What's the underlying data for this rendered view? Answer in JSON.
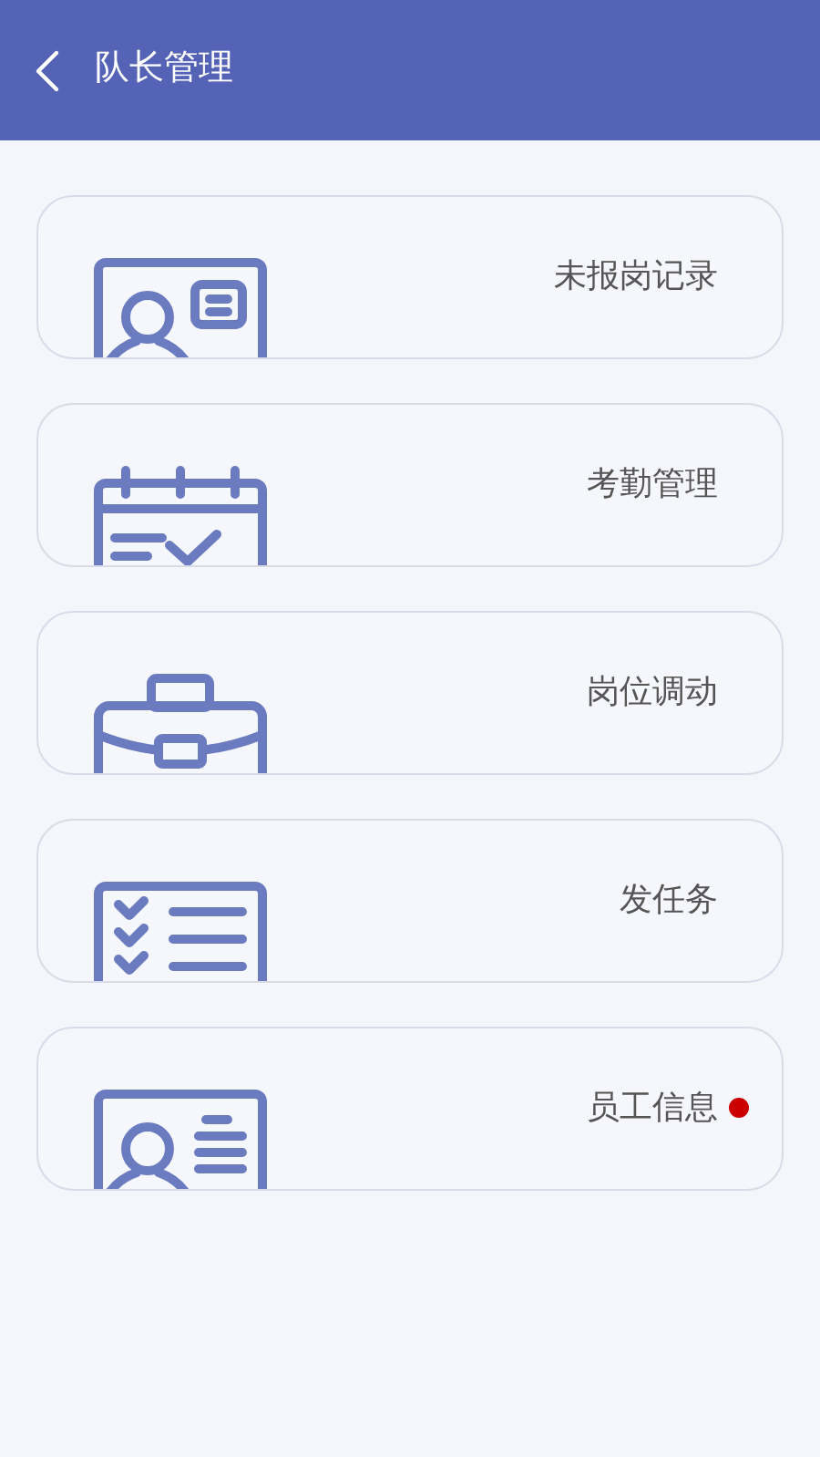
{
  "header": {
    "title": "队长管理"
  },
  "menu": [
    {
      "label": "未报岗记录",
      "kind": "id-card",
      "badge": false
    },
    {
      "label": "考勤管理",
      "kind": "calendar",
      "badge": false
    },
    {
      "label": "岗位调动",
      "kind": "briefcase",
      "badge": false
    },
    {
      "label": "发任务",
      "kind": "checklist",
      "badge": false
    },
    {
      "label": "员工信息",
      "kind": "profile",
      "badge": true
    }
  ]
}
